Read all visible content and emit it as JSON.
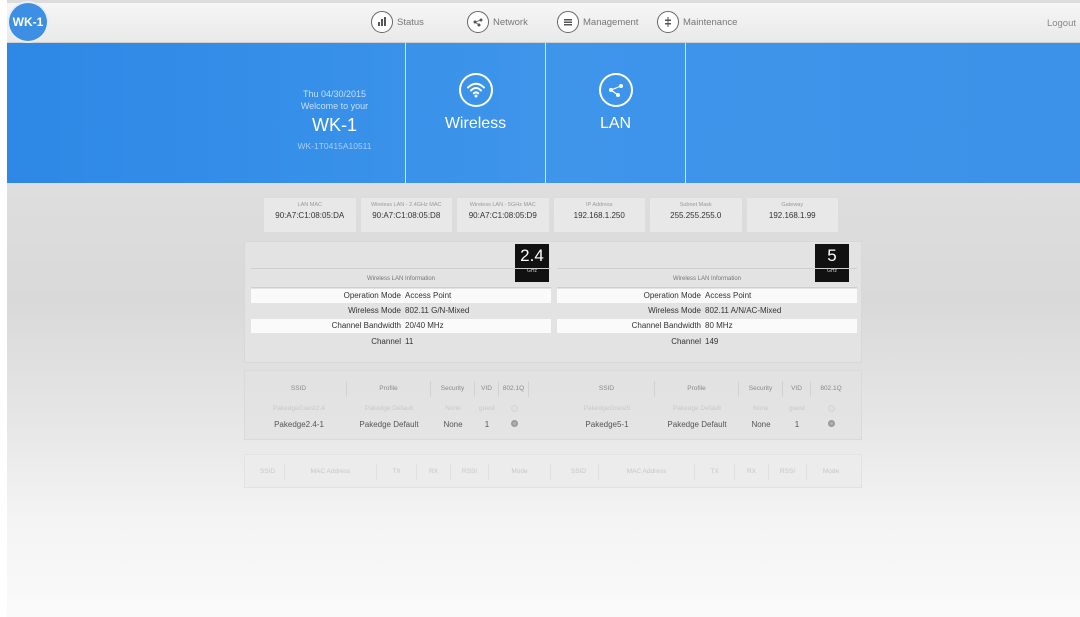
{
  "nav": {
    "logo": "WK-1",
    "items": [
      {
        "label": "Status",
        "icon": "bar-chart-icon"
      },
      {
        "label": "Network",
        "icon": "network-icon"
      },
      {
        "label": "Management",
        "icon": "menu-lines-icon"
      },
      {
        "label": "Maintenance",
        "icon": "sliders-icon"
      }
    ],
    "logout": "Logout"
  },
  "banner": {
    "date": "Thu 04/30/2015",
    "welcome": "Welcome to your",
    "model": "WK-1",
    "serial": "WK-1T0415A10511",
    "tiles": [
      {
        "label": "Wireless",
        "icon": "wifi-icon"
      },
      {
        "label": "LAN",
        "icon": "lan-icon"
      }
    ]
  },
  "info": [
    {
      "label": "LAN MAC",
      "value": "90:A7:C1:08:05:DA"
    },
    {
      "label": "Wireless LAN - 2.4GHz MAC",
      "value": "90:A7:C1:08:05:D8"
    },
    {
      "label": "Wireless LAN - 5GHz MAC",
      "value": "90:A7:C1:08:05:D9"
    },
    {
      "label": "IP Address",
      "value": "192.168.1.250"
    },
    {
      "label": "Subnet Mask",
      "value": "255.255.255.0"
    },
    {
      "label": "Gateway",
      "value": "192.168.1.99"
    }
  ],
  "wireless": {
    "band24": {
      "badge": "2.4",
      "unit": "GHz",
      "header": "Wireless LAN Information",
      "rows": [
        {
          "key": "Operation Mode",
          "value": "Access Point"
        },
        {
          "key": "Wireless Mode",
          "value": "802.11 G/N-Mixed"
        },
        {
          "key": "Channel Bandwidth",
          "value": "20/40 MHz"
        },
        {
          "key": "Channel",
          "value": "11"
        }
      ]
    },
    "band5": {
      "badge": "5",
      "unit": "GHz",
      "header": "Wireless LAN Information",
      "rows": [
        {
          "key": "Operation Mode",
          "value": "Access Point"
        },
        {
          "key": "Wireless Mode",
          "value": "802.11 A/N/AC-Mixed"
        },
        {
          "key": "Channel Bandwidth",
          "value": "80 MHz"
        },
        {
          "key": "Channel",
          "value": "149"
        }
      ]
    }
  },
  "ssid_table": {
    "headers": [
      "SSID",
      "Profile",
      "Security",
      "VID",
      "802.1Q",
      "SSID",
      "Profile",
      "Security",
      "VID",
      "802.1Q"
    ],
    "ghost_row": [
      "PakedgeGuest2.4",
      "Pakedge Default",
      "None",
      "guest",
      "",
      "PakedgeGuest5",
      "Pakedge Default",
      "None",
      "guest",
      ""
    ],
    "row": [
      "Pakedge2.4-1",
      "Pakedge Default",
      "None",
      "1",
      "",
      "Pakedge5-1",
      "Pakedge Default",
      "None",
      "1",
      ""
    ]
  },
  "client_table": {
    "headers": [
      "SSID",
      "MAC Address",
      "TX",
      "RX",
      "RSSI",
      "Mode",
      "SSID",
      "MAC Address",
      "TX",
      "RX",
      "RSSI",
      "Mode"
    ]
  }
}
